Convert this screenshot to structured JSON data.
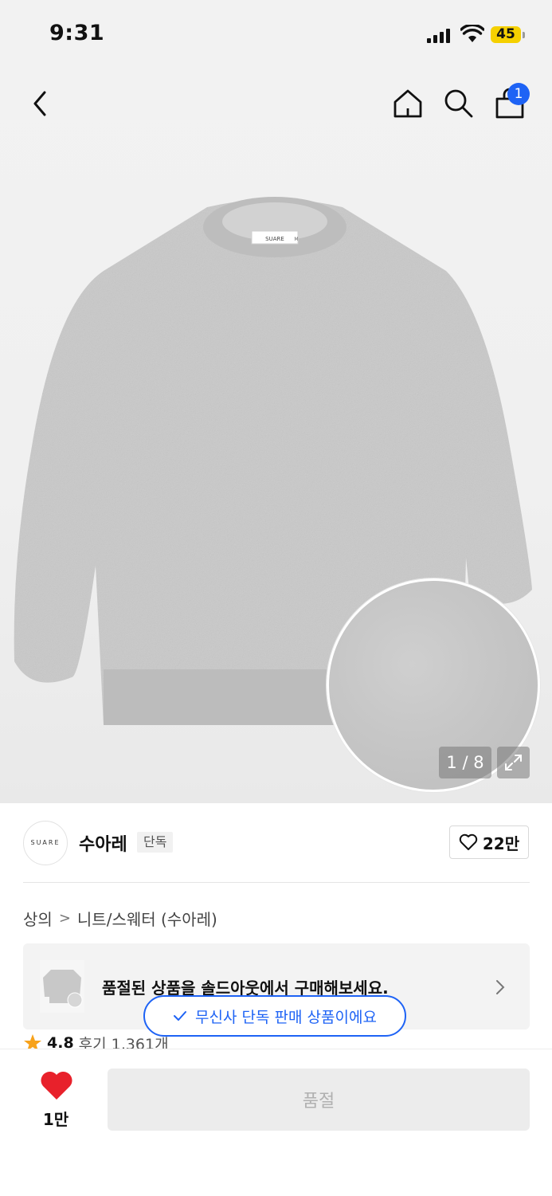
{
  "status_bar": {
    "time": "9:31",
    "battery": "45"
  },
  "nav": {
    "cart_count": "1"
  },
  "gallery": {
    "counter": "1 / 8",
    "label_text": "SUARE",
    "label_size": "M"
  },
  "brand": {
    "logo_text": "SUARE",
    "name": "수아레",
    "tag": "단독",
    "likes": "22만"
  },
  "breadcrumb": {
    "category": "상의",
    "separator": ">",
    "subcategory": "니트/스웨터 (수아레)"
  },
  "banner": {
    "text": "품절된 상품을 솔드아웃에서 구매해보세요."
  },
  "exclusive_pill": {
    "text": "무신사 단독 판매 상품이에요"
  },
  "rating": {
    "score": "4.8",
    "reviews": "후기 1,361개"
  },
  "bottom_bar": {
    "wish_count": "1만",
    "buy_label": "품절"
  },
  "colors": {
    "accent": "#1e63f5",
    "heart": "#e8212b",
    "star": "#f7a21b",
    "battery": "#f5d000"
  }
}
